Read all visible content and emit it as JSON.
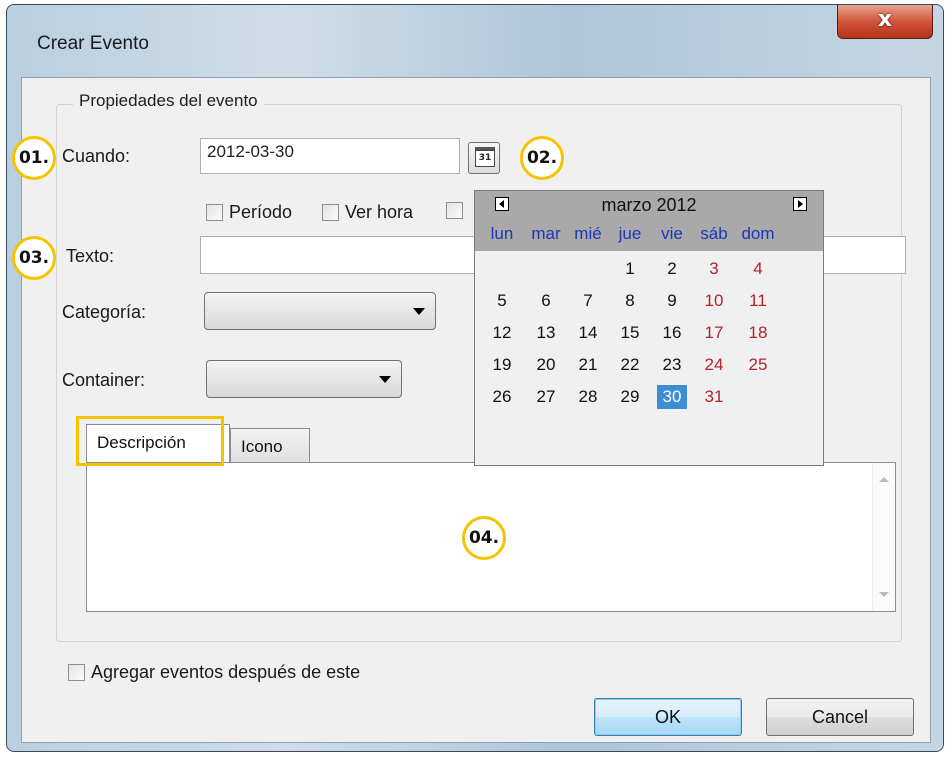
{
  "window": {
    "title": "Crear Evento",
    "close_glyph": "x"
  },
  "group": {
    "label": "Propiedades del evento"
  },
  "form": {
    "when_label": "Cuando:",
    "when_value": "2012-03-30",
    "calendar_button_text": "31",
    "period_label": "Período",
    "show_time_label": "Ver hora",
    "text_label": "Texto:",
    "text_value": "",
    "category_label": "Categoría:",
    "category_value": "",
    "container_label": "Container:",
    "container_value": ""
  },
  "tabs": [
    {
      "label": "Descripción",
      "active": true
    },
    {
      "label": "Icono",
      "active": false
    }
  ],
  "calendar": {
    "month_label": "marzo 2012",
    "weekdays": [
      "lun",
      "mar",
      "mié",
      "jue",
      "vie",
      "sáb",
      "dom"
    ],
    "weeks": [
      [
        "",
        "",
        "",
        "1",
        "2",
        "3",
        "4"
      ],
      [
        "5",
        "6",
        "7",
        "8",
        "9",
        "10",
        "11"
      ],
      [
        "12",
        "13",
        "14",
        "15",
        "16",
        "17",
        "18"
      ],
      [
        "19",
        "20",
        "21",
        "22",
        "23",
        "24",
        "25"
      ],
      [
        "26",
        "27",
        "28",
        "29",
        "30",
        "31",
        ""
      ]
    ],
    "selected_day": "30",
    "weekend_color": "#b3242c",
    "weekday_header_color": "#1c36b8",
    "selected_color": "#3c8cd6"
  },
  "footer": {
    "add_events_after_label": "Agregar eventos después de este",
    "ok_label": "OK",
    "cancel_label": "Cancel"
  },
  "annotations": {
    "badge1": "01.",
    "badge2": "02.",
    "badge3": "03.",
    "badge4": "04.",
    "highlight_color": "#f5c400"
  }
}
